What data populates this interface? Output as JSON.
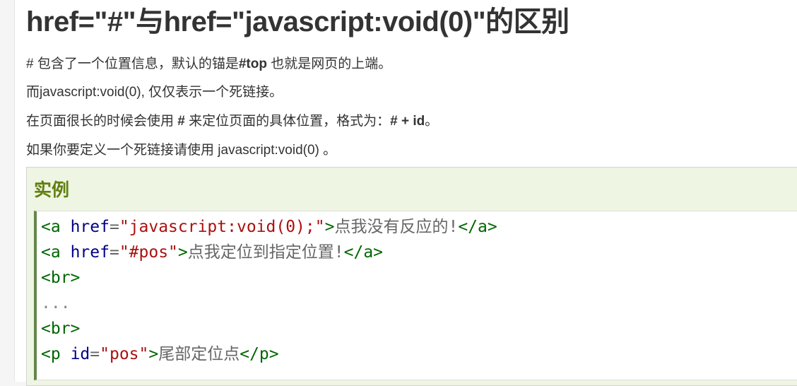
{
  "article": {
    "title": "href=\"#\"与href=\"javascript:void(0)\"的区别",
    "p1": {
      "before": "# 包含了一个位置信息，默认的锚是",
      "bold": "#top",
      "after": " 也就是网页的上端。"
    },
    "p2": "而javascript:void(0), 仅仅表示一个死链接。",
    "p3": {
      "before": "在页面很长的时候会使用 ",
      "bold1": "#",
      "middle": " 来定位页面的具体位置，格式为：",
      "bold2": "# + id",
      "after": "。"
    },
    "p4": "如果你要定义一个死链接请使用 javascript:void(0) 。"
  },
  "example": {
    "title": "实例",
    "code": {
      "line1": {
        "open_tag": "<a",
        "attr": "href",
        "eq": "=",
        "value": "\"javascript:void(0);\"",
        "gt": ">",
        "text": "点我没有反应的!",
        "close_tag": "</a>"
      },
      "line2": {
        "open_tag": "<a",
        "attr": "href",
        "eq": "=",
        "value": "\"#pos\"",
        "gt": ">",
        "text": "点我定位到指定位置!",
        "close_tag": "</a>"
      },
      "line3": "<br>",
      "line4": "...",
      "line5": "<br>",
      "line6": {
        "open_tag": "<p",
        "attr": "id",
        "eq": "=",
        "value": "\"pos\"",
        "gt": ">",
        "text": "尾部定位点",
        "close_tag": "</p>"
      }
    }
  }
}
